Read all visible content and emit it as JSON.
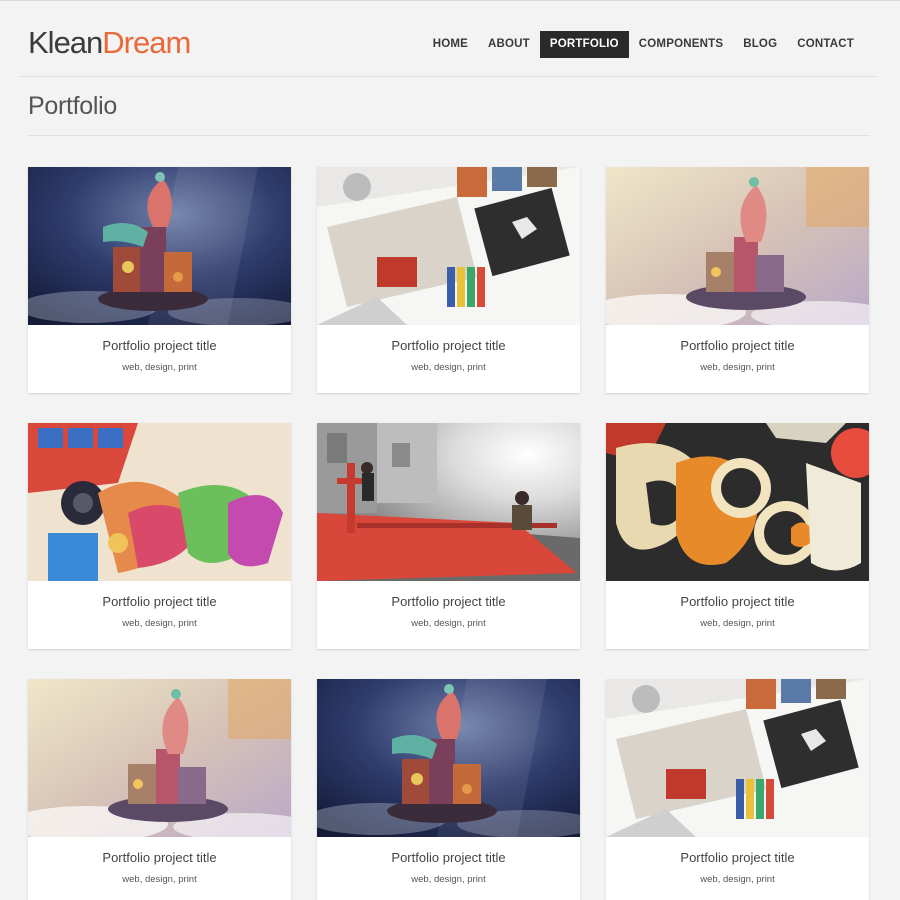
{
  "brand": {
    "name_part1": "Klean",
    "name_part2": "Dream",
    "accent": "#e9693b"
  },
  "nav": [
    {
      "label": "HOME",
      "active": false
    },
    {
      "label": "ABOUT",
      "active": false
    },
    {
      "label": "PORTFOLIO",
      "active": true
    },
    {
      "label": "COMPONENTS",
      "active": false
    },
    {
      "label": "BLOG",
      "active": false
    },
    {
      "label": "CONTACT",
      "active": false
    }
  ],
  "page": {
    "title": "Portfolio"
  },
  "portfolio": [
    {
      "title": "Portfolio project title",
      "tags": "web, design, print",
      "image": "floating-island-night"
    },
    {
      "title": "Portfolio project title",
      "tags": "web, design, print",
      "image": "craft-desk"
    },
    {
      "title": "Portfolio project title",
      "tags": "web, design, print",
      "image": "floating-island-sunset"
    },
    {
      "title": "Portfolio project title",
      "tags": "web, design, print",
      "image": "paper-robot-bird"
    },
    {
      "title": "Portfolio project title",
      "tags": "web, design, print",
      "image": "red-sculpture-street"
    },
    {
      "title": "Portfolio project title",
      "tags": "web, design, print",
      "image": "paper-cutouts"
    },
    {
      "title": "Portfolio project title",
      "tags": "web, design, print",
      "image": "floating-island-sunset"
    },
    {
      "title": "Portfolio project title",
      "tags": "web, design, print",
      "image": "floating-island-night"
    },
    {
      "title": "Portfolio project title",
      "tags": "web, design, print",
      "image": "craft-desk"
    }
  ]
}
